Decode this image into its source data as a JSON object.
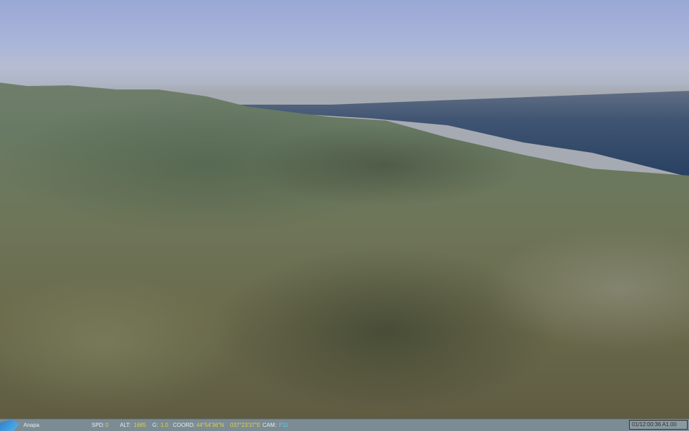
{
  "status_bar": {
    "location": "Anapa",
    "spd_label": "SPD:",
    "spd": "0",
    "alt_label": "ALT:",
    "alt": "1685",
    "g_label": "G:",
    "g": "1.0",
    "coord_label": "COORD:",
    "lat": "44°54'36\"N",
    "lon": "037°23'37\"E",
    "cam_label": "CAM:",
    "cam": "F11",
    "clock": "01/12:00:36 A1.00"
  }
}
